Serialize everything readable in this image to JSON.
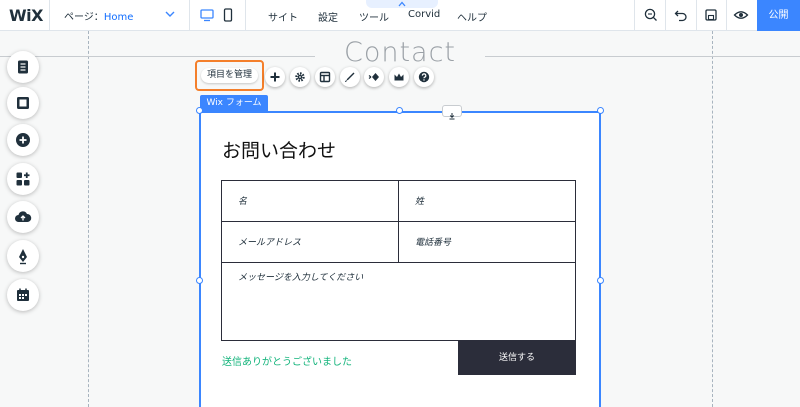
{
  "topbar": {
    "logo": "WiX",
    "page_label": "ページ：",
    "page_value": "Home",
    "menu": [
      "サイト",
      "設定",
      "ツール",
      "Corvid",
      "ヘルプ"
    ],
    "publish": "公開"
  },
  "canvas": {
    "section_title": "Contact"
  },
  "sidebar": {
    "icons": [
      "pages-icon",
      "background-icon",
      "add-icon",
      "add-apps-icon",
      "upload-icon",
      "pen-icon",
      "business-icon"
    ]
  },
  "toolbar": {
    "manage_label": "項目を管理",
    "tools": [
      "plus-icon",
      "gear-icon",
      "layout-icon",
      "design-icon",
      "animation-icon",
      "crown-icon",
      "help-icon"
    ]
  },
  "form": {
    "tag": "Wix フォーム",
    "heading": "お問い合わせ",
    "first_name": "名",
    "last_name": "姓",
    "email": "メールアドレス",
    "phone": "電話番号",
    "message": "メッセージを入力してください",
    "success": "送信ありがとうございました",
    "submit": "送信する"
  },
  "colors": {
    "accent": "#3b86ff",
    "highlight": "#f47f2b",
    "success": "#11b37a",
    "dark": "#2b2d3a"
  }
}
